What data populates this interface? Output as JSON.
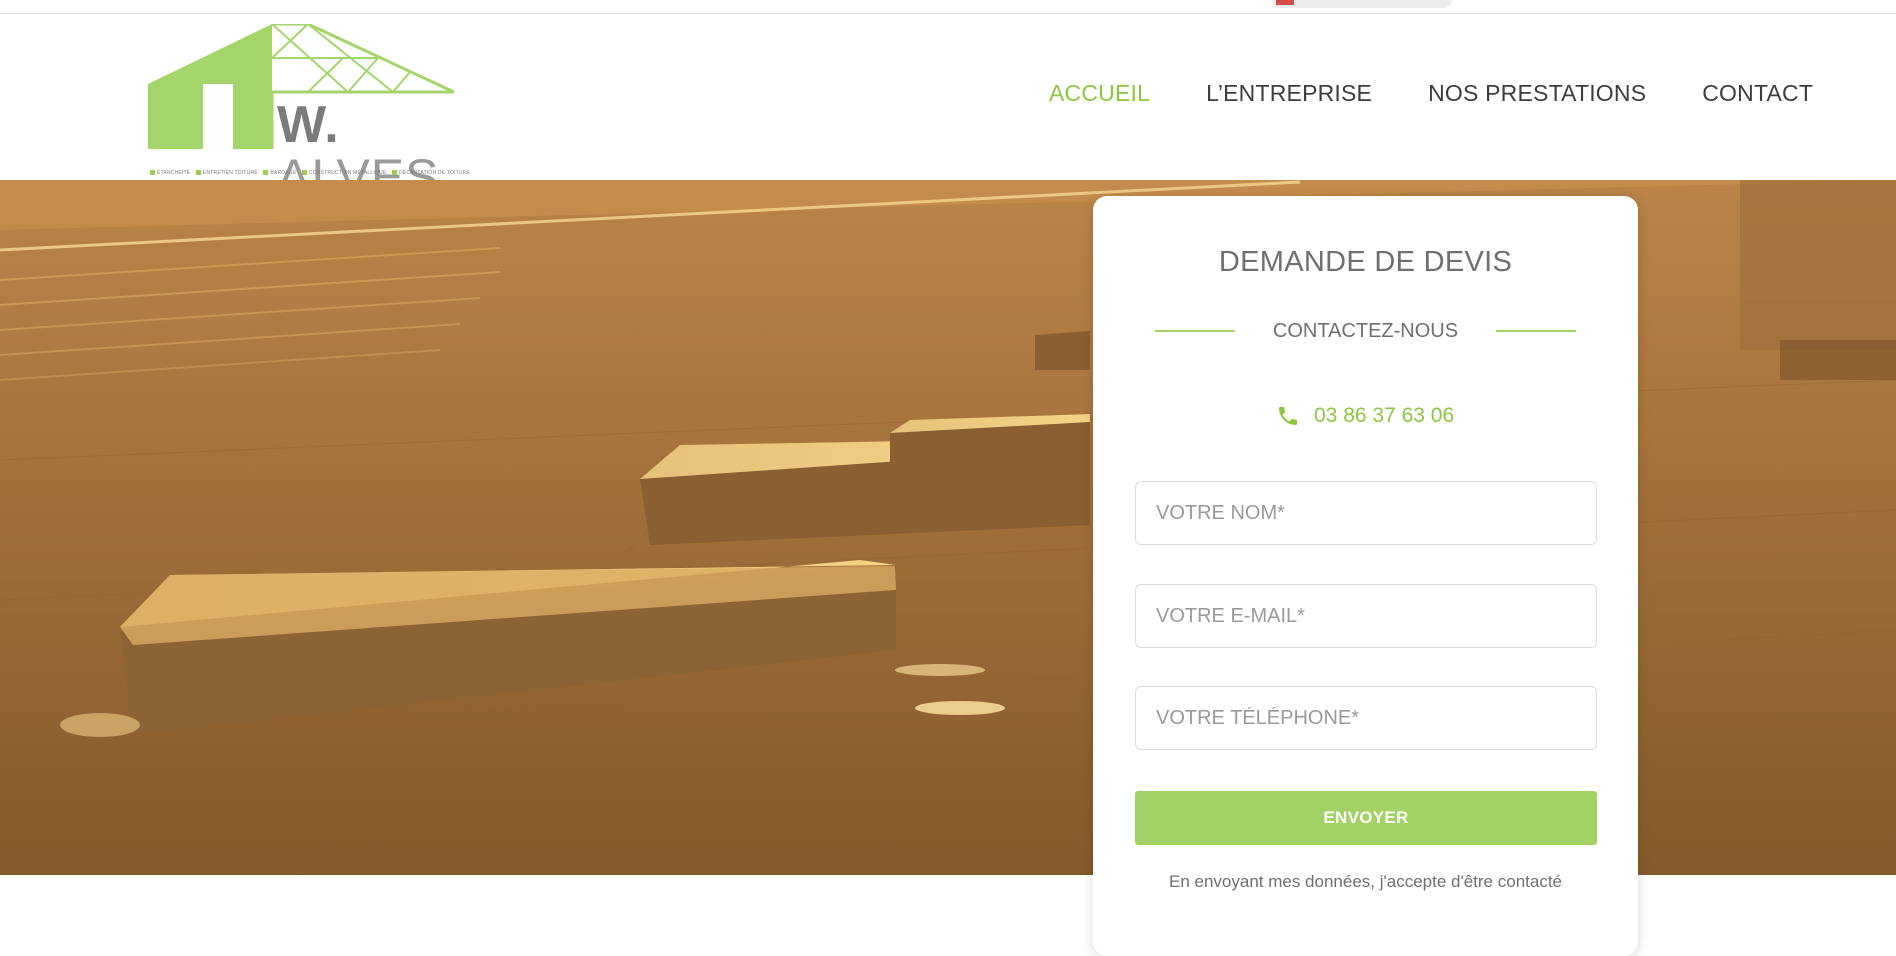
{
  "brand": {
    "initial": "W.",
    "surname": "ALVES",
    "taglines": [
      "ÉTANCHÉITÉ",
      "ENTRETIEN TOITURE",
      "BARDAGE",
      "CONSTRUCTION MÉTALLIQUE",
      "DÉCANTATION DE TOITURE"
    ],
    "accent_color": "#8cc63f"
  },
  "nav": {
    "items": [
      {
        "label": "ACCUEIL",
        "active": true
      },
      {
        "label": "L’ENTREPRISE",
        "active": false
      },
      {
        "label": "NOS PRESTATIONS",
        "active": false
      },
      {
        "label": "CONTACT",
        "active": false
      }
    ]
  },
  "form": {
    "title": "DEMANDE DE DEVIS",
    "subtitle": "CONTACTEZ-NOUS",
    "phone": "03 86 37 63 06",
    "fields": {
      "name_placeholder": "VOTRE NOM*",
      "email_placeholder": "VOTRE E-MAIL*",
      "phone_placeholder": "VOTRE TÉLÉPHONE*"
    },
    "submit_label": "ENVOYER",
    "consent_text": "En envoyant mes données, j'accepte d'être contacté"
  },
  "icons": {
    "phone": "phone-icon",
    "logo": "house-frame-logo-icon"
  },
  "hero": {
    "image_subject": "roof-skylights-at-sunset"
  }
}
